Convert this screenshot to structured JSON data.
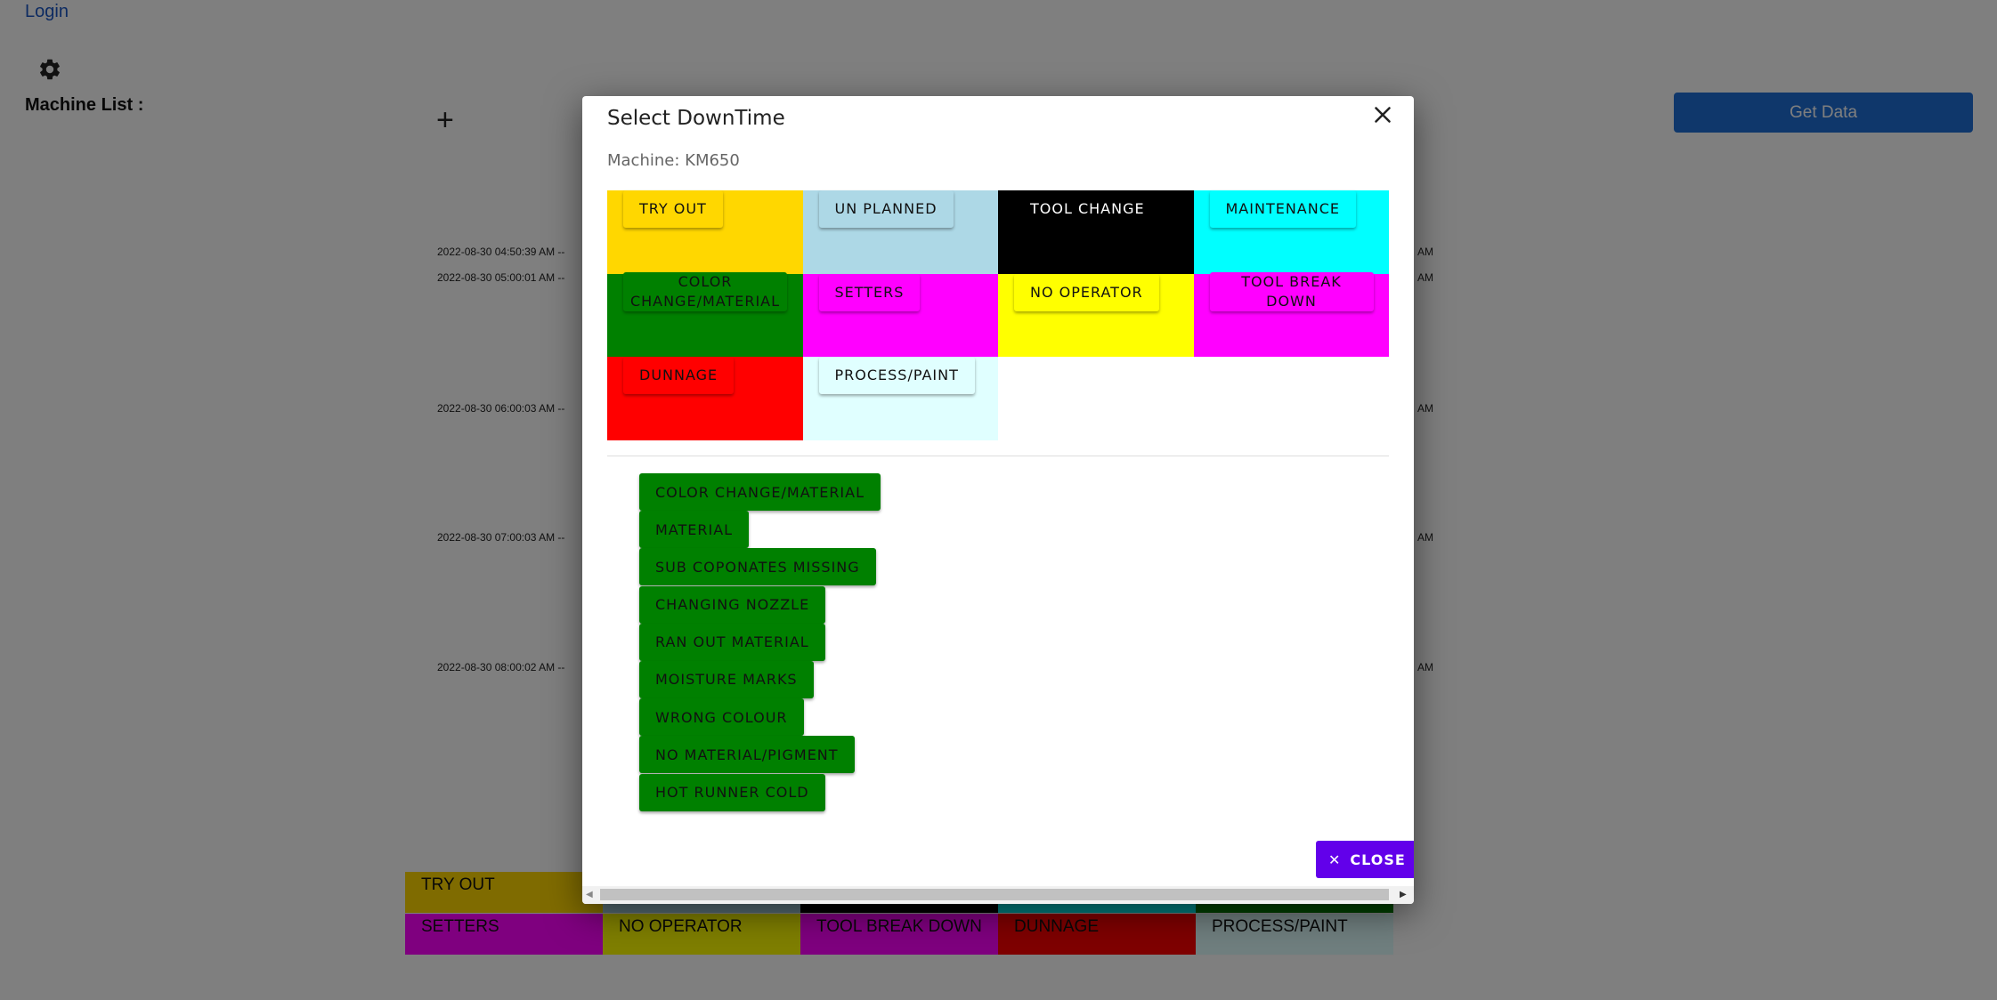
{
  "header": {
    "login": "Login",
    "machine_list_label": "Machine List :",
    "add_symbol": "+",
    "get_data": "Get Data"
  },
  "timeline": {
    "timestamps": [
      "2022-08-30 04:50:39 AM --",
      "2022-08-30 05:00:01 AM --",
      "2022-08-30 06:00:03 AM --",
      "2022-08-30 07:00:03 AM --",
      "2022-08-30 08:00:02 AM --"
    ],
    "right_suffix": "AM"
  },
  "legend": {
    "row1": [
      {
        "label": "TRY OUT",
        "color": "#ffd700"
      },
      {
        "label": "",
        "color": "#add8e6"
      },
      {
        "label": "",
        "color": "#000000"
      },
      {
        "label": "",
        "color": "#00ffff"
      },
      {
        "label": "",
        "color": "#008000"
      }
    ],
    "row2": [
      {
        "label": "SETTERS",
        "color": "#ff00ff"
      },
      {
        "label": "NO OPERATOR",
        "color": "#ffff00"
      },
      {
        "label": "TOOL BREAK DOWN",
        "color": "#ff00ff"
      },
      {
        "label": "DUNNAGE",
        "color": "#ff0000"
      },
      {
        "label": "PROCESS/PAINT",
        "color": "#e0ffff"
      }
    ]
  },
  "modal": {
    "title": "Select DownTime",
    "machine": "Machine: KM650",
    "categories": [
      {
        "label": "TRY OUT",
        "bg": "#ffd700",
        "btn": "#ffd700",
        "text": "#111111"
      },
      {
        "label": "UN PLANNED",
        "bg": "#add8e6",
        "btn": "#add8e6",
        "text": "#111111"
      },
      {
        "label": "TOOL CHANGE",
        "bg": "#000000",
        "btn": "#000000",
        "text": "#ffffff"
      },
      {
        "label": "MAINTENANCE",
        "bg": "#00ffff",
        "btn": "#00ffff",
        "text": "#111111"
      },
      {
        "label": "COLOR CHANGE/MATERIAL",
        "bg": "#008000",
        "btn": "#008000",
        "text": "#111111"
      },
      {
        "label": "SETTERS",
        "bg": "#ff00ff",
        "btn": "#ff00ff",
        "text": "#111111"
      },
      {
        "label": "NO OPERATOR",
        "bg": "#ffff00",
        "btn": "#ffff00",
        "text": "#111111"
      },
      {
        "label": "TOOL BREAK DOWN",
        "bg": "#ff00ff",
        "btn": "#ff00ff",
        "text": "#111111"
      },
      {
        "label": "DUNNAGE",
        "bg": "#ff0000",
        "btn": "#ff0000",
        "text": "#111111"
      },
      {
        "label": "PROCESS/PAINT",
        "bg": "#e0ffff",
        "btn": "#e0ffff",
        "text": "#111111"
      }
    ],
    "subreasons": [
      "COLOR CHANGE/MATERIAL",
      "MATERIAL",
      "SUB COPONATES MISSING",
      "CHANGING NOZZLE",
      "RAN OUT MATERIAL",
      "MOISTURE MARKS",
      "WRONG COLOUR",
      "NO MATERIAL/PIGMENT",
      "HOT RUNNER COLD"
    ],
    "close_label": "CLOSE",
    "close_icon": "close-icon"
  }
}
